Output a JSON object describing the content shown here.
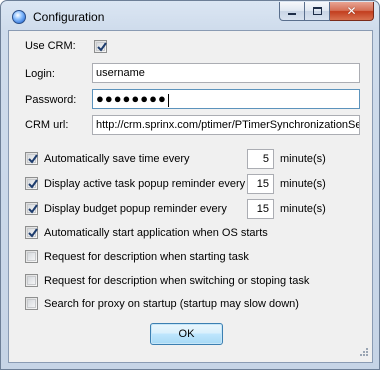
{
  "window": {
    "title": "Configuration",
    "icon": "globe-icon"
  },
  "form": {
    "use_crm_label": "Use CRM:",
    "use_crm_checked": true,
    "login_label": "Login:",
    "login_value": "username",
    "password_label": "Password:",
    "password_value": "●●●●●●●●",
    "crm_url_label": "CRM url:",
    "crm_url_value": "http://crm.sprinx.com/ptimer/PTimerSynchronizationSe"
  },
  "options": [
    {
      "label": "Automatically save time every",
      "checked": true,
      "value": "5",
      "unit": "minute(s)"
    },
    {
      "label": "Display active task popup reminder every",
      "checked": true,
      "value": "15",
      "unit": "minute(s)"
    },
    {
      "label": "Display budget popup reminder every",
      "checked": true,
      "value": "15",
      "unit": "minute(s)"
    },
    {
      "label": "Automatically start application when OS starts",
      "checked": true
    },
    {
      "label": "Request for description when starting task",
      "checked": false
    },
    {
      "label": "Request for description when switching or stoping task",
      "checked": false
    },
    {
      "label": "Search for proxy on startup (startup may slow down)",
      "checked": false
    }
  ],
  "ok_label": "OK"
}
